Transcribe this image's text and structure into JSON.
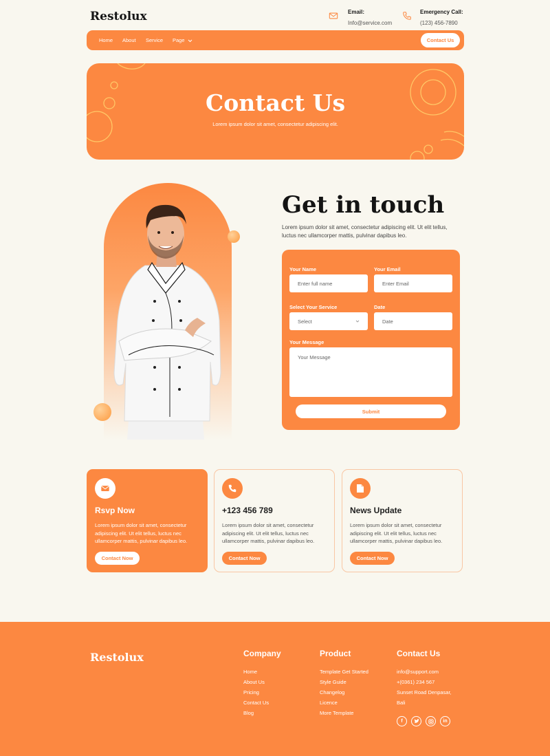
{
  "brand": "Restolux",
  "header": {
    "email_label": "Email:",
    "email_value": "Info@service.com",
    "call_label": "Emergency Call:",
    "call_value": "(123) 456-7890"
  },
  "nav": {
    "items": [
      "Home",
      "About",
      "Service",
      "Page"
    ],
    "contact_button": "Contact Us"
  },
  "hero": {
    "title": "Contact Us",
    "subtitle": "Lorem ipsum dolor sit amet, consectetur adipiscing elit."
  },
  "contact": {
    "title": "Get in touch",
    "text": "Lorem ipsum dolor sit amet, consectetur adipiscing elit. Ut elit tellus, luctus nec ullamcorper mattis, pulvinar dapibus leo."
  },
  "form": {
    "name_label": "Your Name",
    "name_placeholder": "Enter full name",
    "email_label": "Your Email",
    "email_placeholder": "Enter Email",
    "service_label": "Select Your Service",
    "service_value": "Select",
    "date_label": "Date",
    "date_placeholder": "Date",
    "message_label": "Your Message",
    "message_placeholder": "Your Message",
    "submit": "Submit"
  },
  "cards": [
    {
      "title": "Rsvp Now",
      "text": "Lorem ipsum dolor sit amet, consectetur adipiscing elit. Ut elit tellus, luctus nec ullamcorper mattis, pulvinar dapibus leo.",
      "button": "Contact Now",
      "icon": "envelope-icon"
    },
    {
      "title": "+123 456 789",
      "text": "Lorem ipsum dolor sit amet, consectetur adipiscing elit. Ut elit tellus, luctus nec ullamcorper mattis, pulvinar dapibus leo.",
      "button": "Contact Now",
      "icon": "phone-icon"
    },
    {
      "title": "News Update",
      "text": "Lorem ipsum dolor sit amet, consectetur adipiscing elit. Ut elit tellus, luctus nec ullamcorper mattis, pulvinar dapibus leo.",
      "button": "Contact Now",
      "icon": "document-icon"
    }
  ],
  "footer": {
    "brand": "Restolux",
    "company": {
      "title": "Company",
      "links": [
        "Home",
        "About Us",
        "Pricing",
        "Contact Us",
        "Blog"
      ]
    },
    "product": {
      "title": "Product",
      "links": [
        "Template Get Started",
        "Style Guide",
        "Changelog",
        "Licence",
        "More Template"
      ]
    },
    "contact": {
      "title": "Contact Us",
      "lines": [
        "info@support.com",
        "+(0361) 234 567",
        "Sunset Road Denpasar,",
        "Bali"
      ]
    },
    "social": [
      "facebook-icon",
      "twitter-icon",
      "instagram-icon",
      "linkedin-icon"
    ]
  },
  "colors": {
    "accent": "#FC8841",
    "background": "#F9F7EF",
    "text": "#1F1F1F"
  }
}
